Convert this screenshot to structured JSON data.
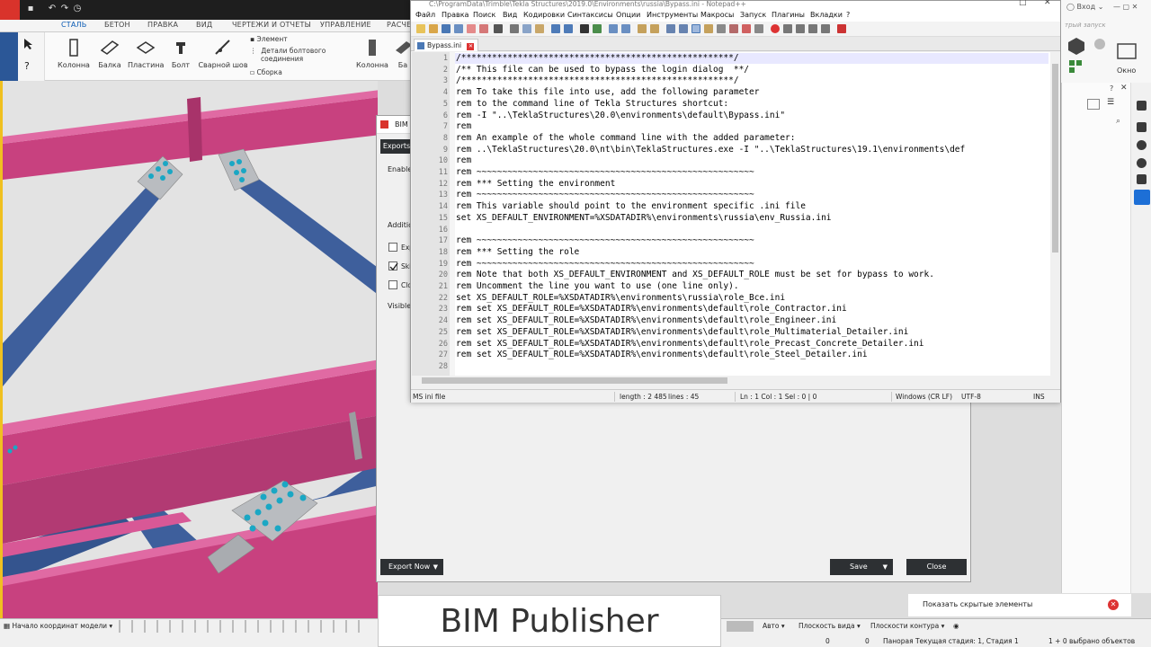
{
  "tekla": {
    "ribbon_tabs": [
      "СТАЛЬ",
      "БЕТОН",
      "ПРАВКА",
      "ВИД",
      "ЧЕРТЕЖИ И ОТЧЕТЫ",
      "УПРАВЛЕНИЕ",
      "РАСЧЕ"
    ],
    "ribbon": {
      "column": "Колонна",
      "beam": "Балка",
      "plate": "Пластина",
      "bolt": "Болт",
      "weld": "Сварной шов",
      "element": "Элемент",
      "bolted_parts_line1": "Детали болтового",
      "bolted_parts_line2": "соединения",
      "assembly": "Сборка",
      "column2": "Колонна",
      "cut_label": "Ба"
    },
    "right_top": {
      "login": "Вход",
      "quick_launch": "трый запуск",
      "window": "Окно"
    }
  },
  "bim_dialog": {
    "title": "BIM",
    "tab_exports": "Exports",
    "enabled_label": "Enable",
    "additional_label": "Additio",
    "opt1": "Exp",
    "opt2": "Skip",
    "opt3": "Clo",
    "visible_label": "Visible",
    "export_now": "Export Now",
    "save": "Save",
    "close": "Close"
  },
  "notepad": {
    "title_path": "C:\\ProgramData\\Trimble\\Tekla Structures\\2019.0\\Environments\\russia\\Bypass.ini - Notepad++",
    "menu": [
      "Файл",
      "Правка",
      "Поиск",
      "Вид",
      "Кодировки",
      "Синтаксисы",
      "Опции",
      "Инструменты",
      "Макросы",
      "Запуск",
      "Плагины",
      "Вкладки",
      "?"
    ],
    "tab": "Bypass.ini",
    "line_numbers": [
      "1",
      "2",
      "3",
      "4",
      "5",
      "6",
      "7",
      "8",
      "9",
      "10",
      "11",
      "12",
      "13",
      "14",
      "15",
      "16",
      "17",
      "18",
      "19",
      "20",
      "21",
      "22",
      "23",
      "24",
      "25",
      "26",
      "27",
      "28"
    ],
    "lines": [
      "/*****************************************************/",
      "/** This file can be used to bypass the login dialog  **/",
      "/*****************************************************/",
      "rem To take this file into use, add the following parameter",
      "rem to the command line of Tekla Structures shortcut:",
      "rem -I \"..\\TeklaStructures\\20.0\\environments\\default\\Bypass.ini\"",
      "rem",
      "rem An example of the whole command line with the added parameter:",
      "rem ..\\TeklaStructures\\20.0\\nt\\bin\\TeklaStructures.exe -I \"..\\TeklaStructures\\19.1\\environments\\def",
      "rem",
      "rem ~~~~~~~~~~~~~~~~~~~~~~~~~~~~~~~~~~~~~~~~~~~~~~~~~~~~~~",
      "rem *** Setting the environment",
      "rem ~~~~~~~~~~~~~~~~~~~~~~~~~~~~~~~~~~~~~~~~~~~~~~~~~~~~~~",
      "rem This variable should point to the environment specific .ini file",
      "set XS_DEFAULT_ENVIRONMENT=%XSDATADIR%\\environments\\russia\\env_Russia.ini",
      "",
      "rem ~~~~~~~~~~~~~~~~~~~~~~~~~~~~~~~~~~~~~~~~~~~~~~~~~~~~~~",
      "rem *** Setting the role",
      "rem ~~~~~~~~~~~~~~~~~~~~~~~~~~~~~~~~~~~~~~~~~~~~~~~~~~~~~~",
      "rem Note that both XS_DEFAULT_ENVIRONMENT and XS_DEFAULT_ROLE must be set for bypass to work.",
      "rem Uncomment the line you want to use (one line only).",
      "set XS_DEFAULT_ROLE=%XSDATADIR%\\environments\\russia\\role_Все.ini",
      "rem set XS_DEFAULT_ROLE=%XSDATADIR%\\environments\\default\\role_Contractor.ini",
      "rem set XS_DEFAULT_ROLE=%XSDATADIR%\\environments\\default\\role_Engineer.ini",
      "rem set XS_DEFAULT_ROLE=%XSDATADIR%\\environments\\default\\role_Multimaterial_Detailer.ini",
      "rem set XS_DEFAULT_ROLE=%XSDATADIR%\\environments\\default\\role_Precast_Concrete_Detailer.ini",
      "rem set XS_DEFAULT_ROLE=%XSDATADIR%\\environments\\default\\role_Steel_Detailer.ini",
      ""
    ],
    "status": {
      "file_type": "MS ini file",
      "length": "length : 2 485",
      "lines": "lines : 45",
      "position": "Ln : 1    Col : 1    Sel : 0 | 0",
      "eol": "Windows (CR LF)",
      "encoding": "UTF-8",
      "mode": "INS"
    }
  },
  "bottom": {
    "origin": "Начало координат модели",
    "auto": "Авто",
    "view_plane": "Плоскость вида",
    "contour_plane": "Плоскости контура",
    "hidden_elements": "Показать скрытые элементы",
    "zero1": "0",
    "zero2": "0",
    "stage": "Панорая Текущая стадия: 1, Стадия 1",
    "selected": "1 + 0 выбрано объектов"
  },
  "caption": "BIM Publisher",
  "colors": {
    "beam_magenta": "#c8417f",
    "beam_blue": "#3e5f9c",
    "plate_grey": "#b9bcc0",
    "bolt_teal": "#1aa7c4",
    "accent_yellow": "#f0c020",
    "dark_button": "#2d3033"
  }
}
